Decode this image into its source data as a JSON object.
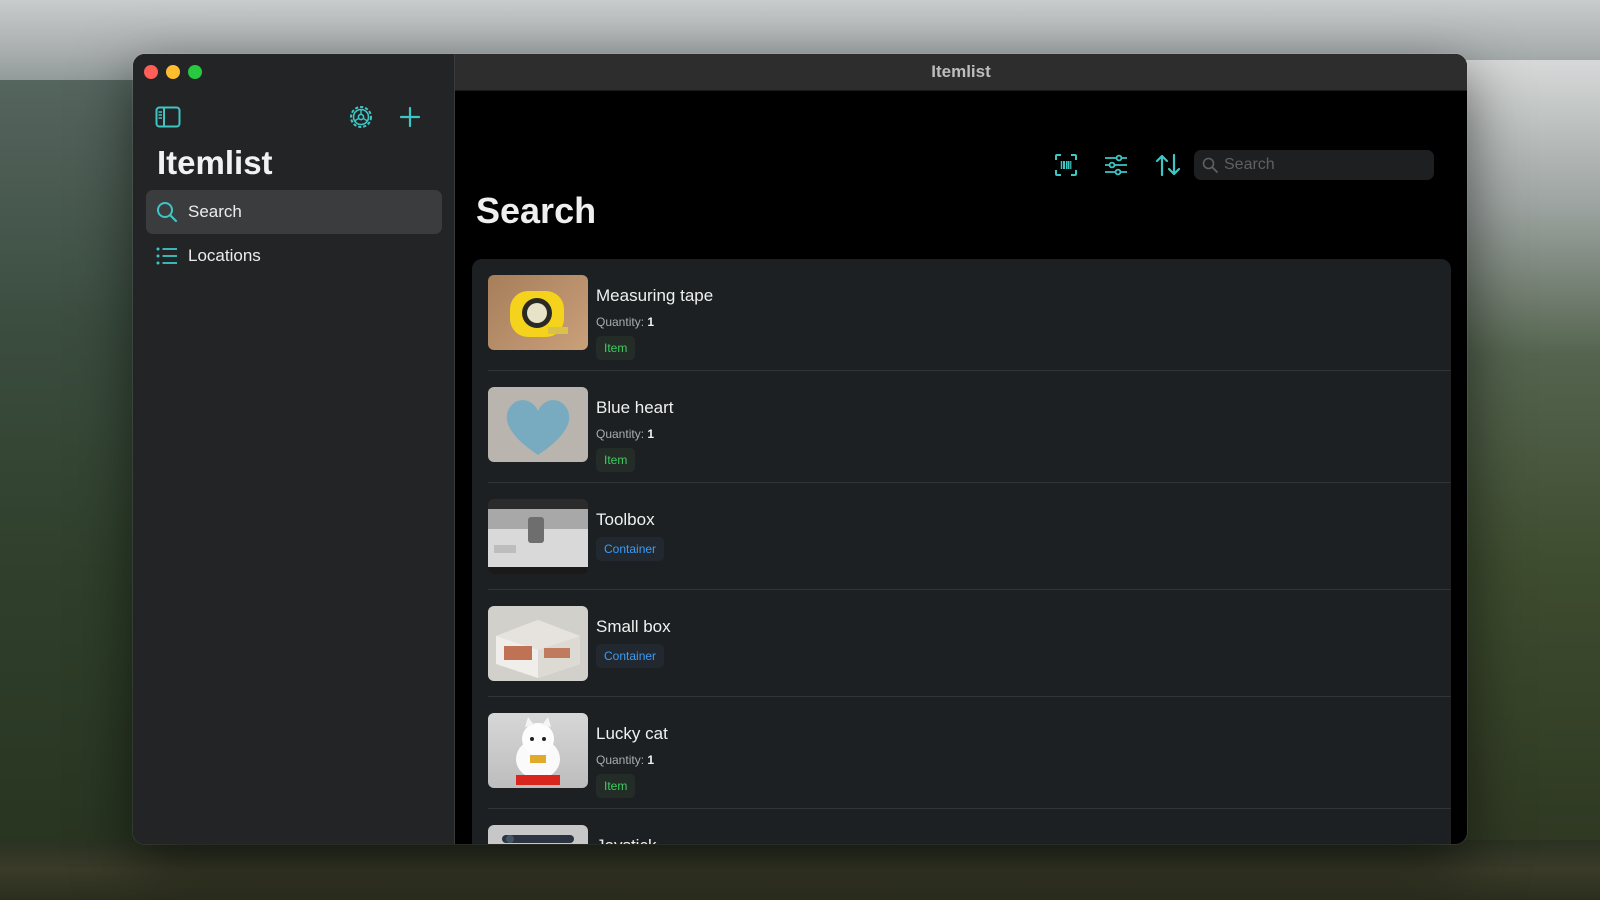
{
  "window": {
    "title": "Itemlist"
  },
  "sidebar": {
    "title": "Itemlist",
    "items": [
      {
        "label": "Search",
        "icon": "search-icon",
        "selected": true
      },
      {
        "label": "Locations",
        "icon": "list-icon",
        "selected": false
      }
    ]
  },
  "toolbar": {
    "search_placeholder": "Search",
    "icons": [
      "barcode-scan-icon",
      "filter-sliders-icon",
      "sort-arrows-icon"
    ]
  },
  "main": {
    "title": "Search",
    "items": [
      {
        "name": "Measuring tape",
        "quantity_label": "Quantity:",
        "quantity": "1",
        "type": "Item",
        "image": "measuring-tape"
      },
      {
        "name": "Blue heart",
        "quantity_label": "Quantity:",
        "quantity": "1",
        "type": "Item",
        "image": "blue-heart"
      },
      {
        "name": "Toolbox",
        "type": "Container",
        "image": "toolbox"
      },
      {
        "name": "Small box",
        "type": "Container",
        "image": "small-box"
      },
      {
        "name": "Lucky cat",
        "quantity_label": "Quantity:",
        "quantity": "1",
        "type": "Item",
        "image": "lucky-cat"
      },
      {
        "name": "Joystick",
        "image": "joystick"
      }
    ]
  },
  "colors": {
    "accent": "#3ec6c4",
    "item_badge": "#3fcd61",
    "container_badge": "#3d9bf5",
    "close": "#fe5f57",
    "minimize": "#febc2e",
    "zoom": "#28c840"
  }
}
